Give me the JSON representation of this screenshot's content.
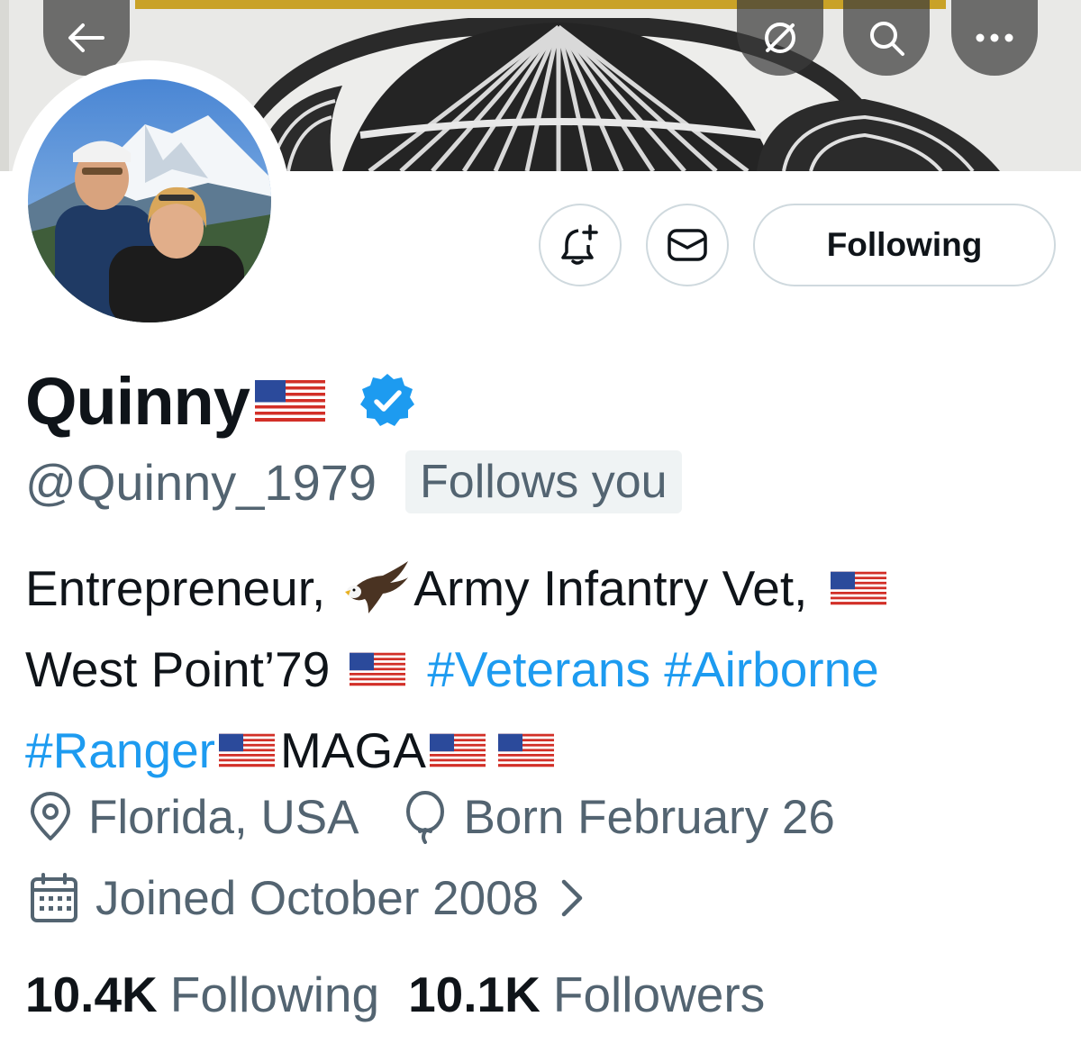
{
  "header": {
    "back_icon": "arrow-left-icon",
    "grok_icon": "slash-circle-icon",
    "search_icon": "search-icon",
    "more_icon": "more-dots-icon"
  },
  "actions": {
    "notify_icon": "bell-plus-icon",
    "message_icon": "envelope-icon",
    "follow_label": "Following"
  },
  "profile": {
    "name": "Quinny",
    "handle": "@Quinny_1979",
    "follows_you": "Follows you",
    "verified_color": "#1d9bf0"
  },
  "bio": {
    "line1_a": "Entrepreneur,",
    "line1_b": "Army Infantry Vet,",
    "line2_a": "West Point’79",
    "line2_tags": "#Veterans #Airborne",
    "line3_tag": "#Ranger",
    "line3_b": "MAGA"
  },
  "meta": {
    "location": "Florida, USA",
    "birthday": "Born February 26",
    "joined": "Joined October 2008"
  },
  "stats": {
    "following_count": "10.4K",
    "following_label": "Following",
    "followers_count": "10.1K",
    "followers_label": "Followers"
  },
  "colors": {
    "link": "#1d9bf0",
    "secondary_text": "#536471",
    "border": "#cfd9de"
  }
}
